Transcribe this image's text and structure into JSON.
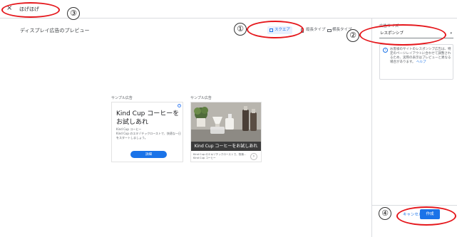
{
  "header": {
    "close_icon": "×",
    "title": "ほげほげ"
  },
  "preview": {
    "title": "ディスプレイ広告のプレビュー"
  },
  "shape_tabs": [
    {
      "label": "スクエア",
      "active": true
    },
    {
      "label": "縦長タイプ"
    },
    {
      "label": "横長タイプ"
    }
  ],
  "sidebar": {
    "label": "広告サイズ",
    "selected": "レスポンシブ",
    "caret": "▾",
    "info_icon": "i",
    "info_text": "お客様のサイトのレスポンシブ広告は、特定のページレイアウトに合わせて調整されるため、実際の表示はプレビューと異なる場合があります。",
    "info_link": "ヘルプ"
  },
  "ads": {
    "label1": "サンプル広告",
    "label2": "サンプル広告",
    "ad1": {
      "adchoices_icon": "i",
      "headline": "Kind Cup コーヒーをお試しあれ",
      "advertiser": "Kind Cup コーヒー",
      "description": "Kind Cup のエキゾチックローストで、快適な一日をスタートしましょう。",
      "cta": "詳細"
    },
    "ad2": {
      "headline": "Kind Cup コーヒーをお試しあれ",
      "description": "Kind Cup のエキゾチックローストで、快適… Kind Cup コーヒー",
      "arrow": "›"
    }
  },
  "footer": {
    "cancel": "キャンセル",
    "create": "作成"
  },
  "annotations": [
    "①",
    "②",
    "③",
    "④"
  ],
  "colors": {
    "accent": "#1a73e8",
    "annotation": "#e5171c"
  }
}
